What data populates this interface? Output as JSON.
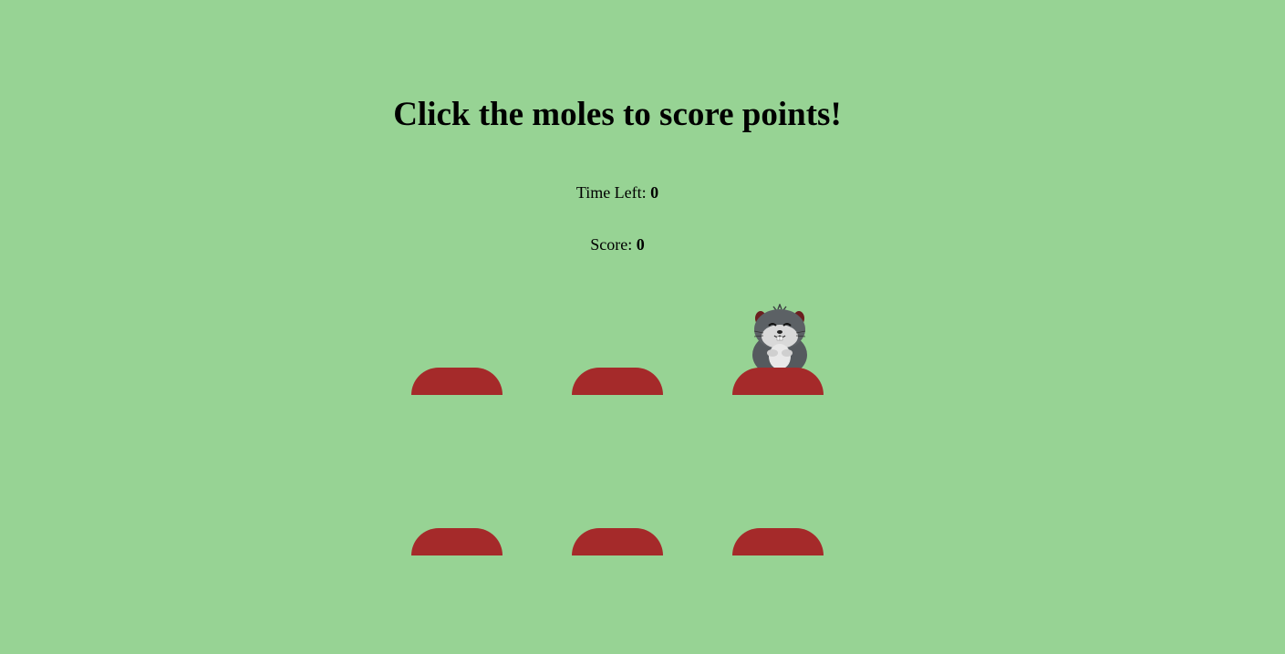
{
  "game": {
    "title": "Click the moles to score points!",
    "time_label": "Time Left:",
    "time_value": "0",
    "score_label": "Score:",
    "score_value": "0"
  },
  "board": {
    "holes": [
      {
        "id": "hole-1",
        "mole_up": false
      },
      {
        "id": "hole-2",
        "mole_up": false
      },
      {
        "id": "hole-3",
        "mole_up": true
      },
      {
        "id": "hole-4",
        "mole_up": false
      },
      {
        "id": "hole-5",
        "mole_up": false
      },
      {
        "id": "hole-6",
        "mole_up": false
      }
    ],
    "colors": {
      "background": "#97d394",
      "hole": "#a52a2a",
      "mole_body": "#555a5e"
    },
    "icons": {
      "mole": "mole-icon"
    }
  }
}
